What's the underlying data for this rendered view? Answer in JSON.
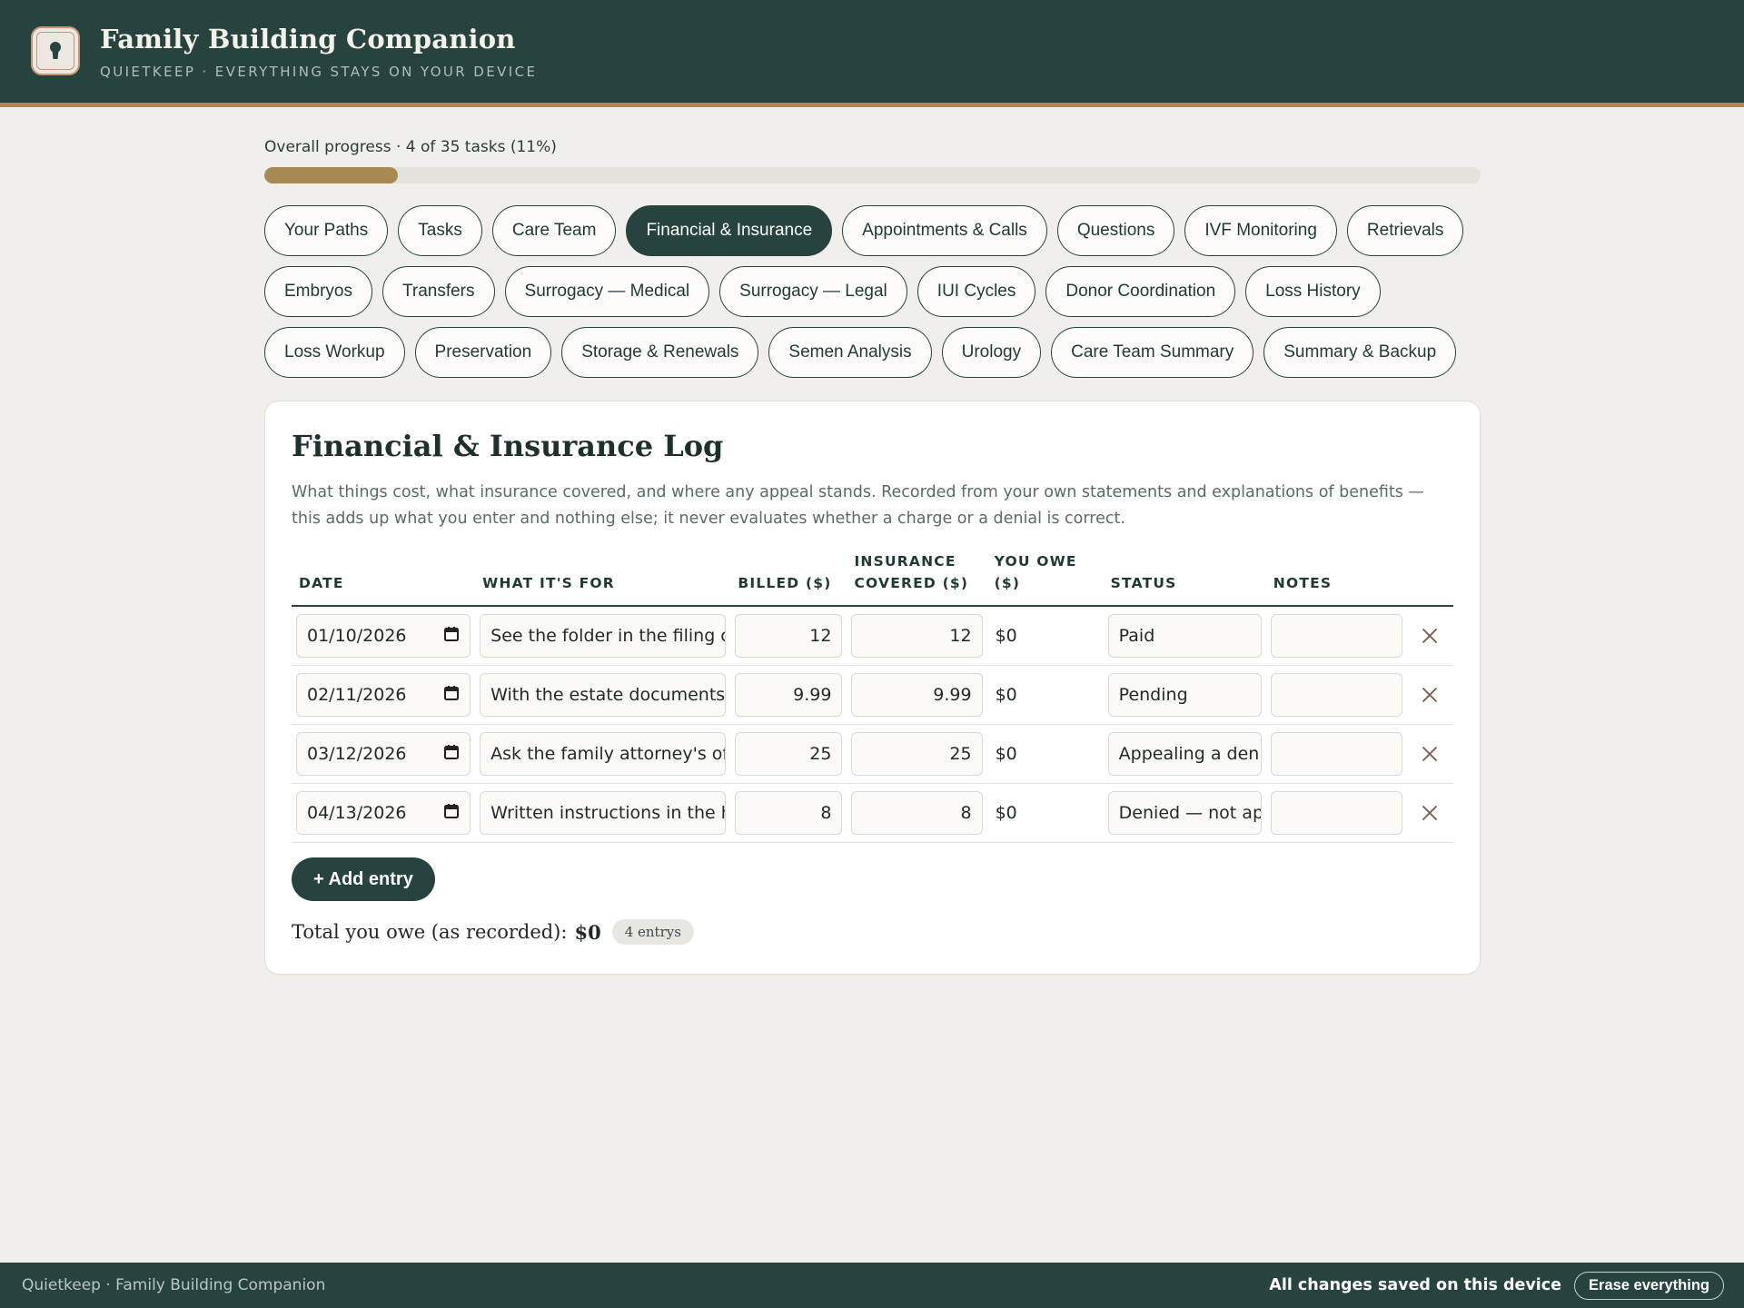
{
  "header": {
    "title": "Family Building Companion",
    "subtitle": "QUIETKEEP · EVERYTHING STAYS ON YOUR DEVICE"
  },
  "progress": {
    "label": "Overall progress · 4 of 35 tasks (11%)",
    "fraction": 0.11
  },
  "tabs": [
    {
      "label": "Your Paths",
      "active": false
    },
    {
      "label": "Tasks",
      "active": false
    },
    {
      "label": "Care Team",
      "active": false
    },
    {
      "label": "Financial & Insurance",
      "active": true
    },
    {
      "label": "Appointments & Calls",
      "active": false
    },
    {
      "label": "Questions",
      "active": false
    },
    {
      "label": "IVF Monitoring",
      "active": false
    },
    {
      "label": "Retrievals",
      "active": false
    },
    {
      "label": "Embryos",
      "active": false
    },
    {
      "label": "Transfers",
      "active": false
    },
    {
      "label": "Surrogacy — Medical",
      "active": false
    },
    {
      "label": "Surrogacy — Legal",
      "active": false
    },
    {
      "label": "IUI Cycles",
      "active": false
    },
    {
      "label": "Donor Coordination",
      "active": false
    },
    {
      "label": "Loss History",
      "active": false
    },
    {
      "label": "Loss Workup",
      "active": false
    },
    {
      "label": "Preservation",
      "active": false
    },
    {
      "label": "Storage & Renewals",
      "active": false
    },
    {
      "label": "Semen Analysis",
      "active": false
    },
    {
      "label": "Urology",
      "active": false
    },
    {
      "label": "Care Team Summary",
      "active": false
    },
    {
      "label": "Summary & Backup",
      "active": false
    }
  ],
  "log": {
    "title": "Financial & Insurance Log",
    "description": "What things cost, what insurance covered, and where any appeal stands. Recorded from your own statements and explanations of benefits — this adds up what you enter and nothing else; it never evaluates whether a charge or a denial is correct.",
    "columns": {
      "date": "DATE",
      "what": "WHAT IT'S FOR",
      "billed": "BILLED ($)",
      "covered": "INSURANCE COVERED ($)",
      "owe": "YOU OWE ($)",
      "status": "STATUS",
      "notes": "NOTES"
    },
    "rows": [
      {
        "date": "01/10/2026",
        "what": "See the folder in the filing cabinet",
        "billed": "12",
        "covered": "12",
        "owe": "$0",
        "status": "Paid",
        "notes": ""
      },
      {
        "date": "02/11/2026",
        "what": "With the estate documents",
        "billed": "9.99",
        "covered": "9.99",
        "owe": "$0",
        "status": "Pending",
        "notes": ""
      },
      {
        "date": "03/12/2026",
        "what": "Ask the family attorney's office",
        "billed": "25",
        "covered": "25",
        "owe": "$0",
        "status": "Appealing a denial",
        "notes": ""
      },
      {
        "date": "04/13/2026",
        "what": "Written instructions in the home safe",
        "billed": "8",
        "covered": "8",
        "owe": "$0",
        "status": "Denied — not appealing",
        "notes": ""
      }
    ],
    "add_label": "+ Add entry",
    "total_label": "Total you owe (as recorded):",
    "total_value": "$0",
    "entry_count": "4 entrys"
  },
  "footer": {
    "left": "Quietkeep · Family Building Companion",
    "saved": "All changes saved on this device",
    "erase_label": "Erase everything"
  },
  "colors": {
    "header_bg": "#264340",
    "accent": "#b3835a",
    "progress_fill": "#a88a55"
  }
}
